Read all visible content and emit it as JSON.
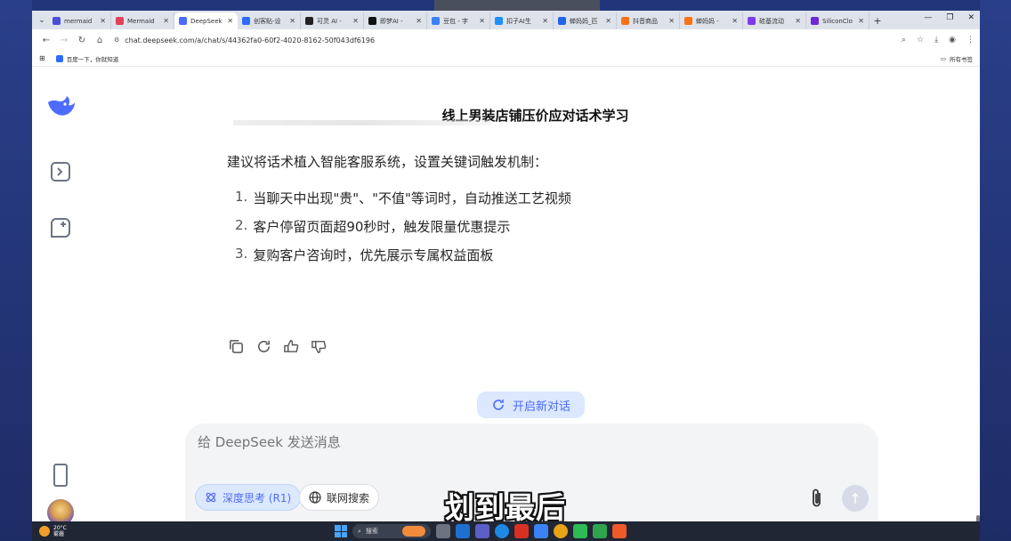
{
  "browser": {
    "tabs": [
      {
        "label": "mermaid",
        "color": "#4a4fd8"
      },
      {
        "label": "Mermaid",
        "color": "#e0425a"
      },
      {
        "label": "DeepSeek",
        "color": "#4d6bfe",
        "active": true
      },
      {
        "label": "创客贴-设",
        "color": "#2f6bff"
      },
      {
        "label": "可灵 AI -",
        "color": "#222222"
      },
      {
        "label": "即梦AI -",
        "color": "#111111"
      },
      {
        "label": "豆包 - 字",
        "color": "#3b82f6"
      },
      {
        "label": "扣子AI生",
        "color": "#1e90ff"
      },
      {
        "label": "蝉妈妈_匹",
        "color": "#2563eb"
      },
      {
        "label": "抖音商品",
        "color": "#f97316"
      },
      {
        "label": "蝉妈妈 - ",
        "color": "#f97316"
      },
      {
        "label": "硅基流动",
        "color": "#7c3aed"
      },
      {
        "label": "SiliconClo",
        "color": "#6d28d9"
      }
    ],
    "url": "chat.deepseek.com/a/chat/s/44362fa0-60f2-4020-8162-50f043df6196",
    "bookmark": "百度一下，你就知道",
    "all_bookmarks": "所有书签"
  },
  "chat": {
    "title": "线上男装店铺压价应对话术学习",
    "intro": "建议将话术植入智能客服系统，设置关键词触发机制：",
    "items": [
      {
        "num": "1.",
        "text": "当聊天中出现\"贵\"、\"不值\"等词时，自动推送工艺视频"
      },
      {
        "num": "2.",
        "text": "客户停留页面超90秒时，触发限量优惠提示"
      },
      {
        "num": "3.",
        "text": "复购客户咨询时，优先展示专属权益面板"
      }
    ],
    "new_chat_label": "开启新对话"
  },
  "composer": {
    "placeholder": "给 DeepSeek 发送消息",
    "deep_think_label": "深度思考 (R1)",
    "web_search_label": "联网搜索"
  },
  "overlay": {
    "subtitle": "划到最后"
  },
  "taskbar": {
    "temp": "20°C",
    "weather": "雾霾",
    "search_label": "搜索"
  },
  "colors": {
    "accent": "#4d6bfe",
    "accent_bg": "#dbe8fd"
  }
}
